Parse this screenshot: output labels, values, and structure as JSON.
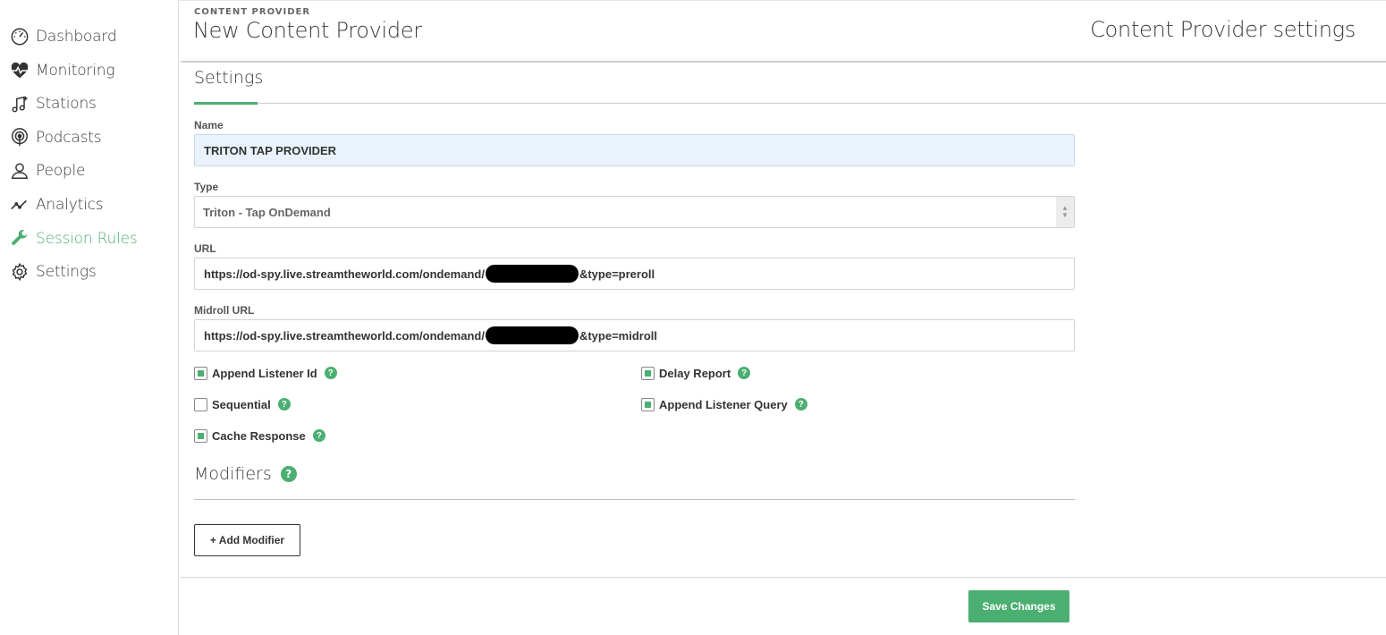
{
  "sidebar": {
    "items": [
      {
        "label": "Dashboard",
        "icon": "dashboard-gauge-icon"
      },
      {
        "label": "Monitoring",
        "icon": "heart-pulse-icon"
      },
      {
        "label": "Stations",
        "icon": "music-note-plus-icon"
      },
      {
        "label": "Podcasts",
        "icon": "podcast-icon"
      },
      {
        "label": "People",
        "icon": "person-icon"
      },
      {
        "label": "Analytics",
        "icon": "trend-line-icon"
      },
      {
        "label": "Session Rules",
        "icon": "wrench-icon",
        "active": true
      },
      {
        "label": "Settings",
        "icon": "gear-icon"
      }
    ]
  },
  "header": {
    "eyebrow": "CONTENT PROVIDER",
    "title": "New Content Provider",
    "right_title": "Content Provider settings"
  },
  "tabs": {
    "settings_label": "Settings"
  },
  "form": {
    "name_label": "Name",
    "name_value": "TRITON TAP PROVIDER",
    "type_label": "Type",
    "type_value": "Triton - Tap OnDemand",
    "url_label": "URL",
    "url_prefix": "https://od-spy.live.streamtheworld.com/ondemand/",
    "url_suffix": "&type=preroll",
    "midroll_label": "Midroll URL",
    "midroll_prefix": "https://od-spy.live.streamtheworld.com/ondemand/",
    "midroll_suffix": "&type=midroll"
  },
  "checkboxes": {
    "append_listener_id": {
      "label": "Append Listener Id",
      "checked": true
    },
    "sequential": {
      "label": "Sequential",
      "checked": false
    },
    "cache_response": {
      "label": "Cache Response",
      "checked": true
    },
    "delay_report": {
      "label": "Delay Report",
      "checked": true
    },
    "append_listener_query": {
      "label": "Append Listener Query",
      "checked": true
    }
  },
  "help_glyph": "?",
  "modifiers": {
    "title": "Modifiers",
    "add_label": "+ Add Modifier"
  },
  "footer": {
    "save_label": "Save Changes"
  },
  "colors": {
    "accent": "#4caf72",
    "input_highlight": "#eaf3fd"
  }
}
